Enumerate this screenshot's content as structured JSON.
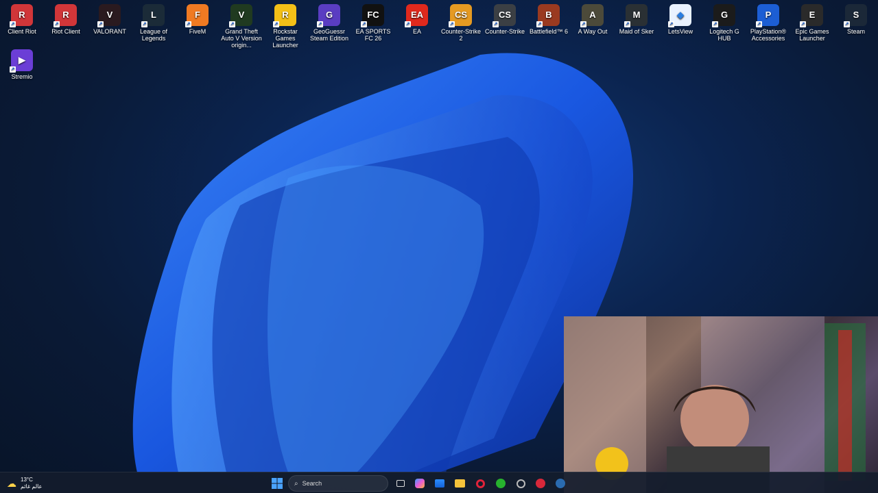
{
  "desktop_icons": [
    {
      "label": "Client Riot",
      "color": "#d13639",
      "glyph": "R"
    },
    {
      "label": "Riot Client",
      "color": "#d13639",
      "glyph": "R"
    },
    {
      "label": "VALORANT",
      "color": "#2a1a1f",
      "glyph": "V"
    },
    {
      "label": "League of Legends",
      "color": "#1b2b38",
      "glyph": "L"
    },
    {
      "label": "FiveM",
      "color": "#f07a22",
      "glyph": "F"
    },
    {
      "label": "Grand Theft Auto V Version origin...",
      "color": "#203a20",
      "glyph": "V"
    },
    {
      "label": "Rockstar Games Launcher",
      "color": "#f4c017",
      "glyph": "R"
    },
    {
      "label": "GeoGuessr Steam Edition",
      "color": "#5a3dc2",
      "glyph": "G"
    },
    {
      "label": "EA SPORTS FC 26",
      "color": "#111111",
      "glyph": "FC"
    },
    {
      "label": "EA",
      "color": "#e0291d",
      "glyph": "EA"
    },
    {
      "label": "Counter-Strike 2",
      "color": "#e59a22",
      "glyph": "CS"
    },
    {
      "label": "Counter-Strike",
      "color": "#3b3f44",
      "glyph": "CS"
    },
    {
      "label": "Battlefield™ 6",
      "color": "#9a3a20",
      "glyph": "B"
    },
    {
      "label": "A Way Out",
      "color": "#4c4a3a",
      "glyph": "A"
    },
    {
      "label": "Maid of Sker",
      "color": "#2a3034",
      "glyph": "M"
    },
    {
      "label": "LetsView",
      "color": "#e9f2ff",
      "glyph": "◆"
    },
    {
      "label": "Logitech G HUB",
      "color": "#1b1b1b",
      "glyph": "G"
    },
    {
      "label": "PlayStation® Accessories",
      "color": "#1c5ed4",
      "glyph": "P"
    },
    {
      "label": "Epic Games Launcher",
      "color": "#2a2a2a",
      "glyph": "E"
    },
    {
      "label": "Steam",
      "color": "#1b2838",
      "glyph": "S"
    }
  ],
  "second_row_icons": [
    {
      "label": "Stremio",
      "color": "#6b3ed6",
      "glyph": "▶"
    }
  ],
  "taskbar": {
    "search_placeholder": "Search",
    "weather_temp": "13°C",
    "weather_desc": "عالم غائم"
  }
}
